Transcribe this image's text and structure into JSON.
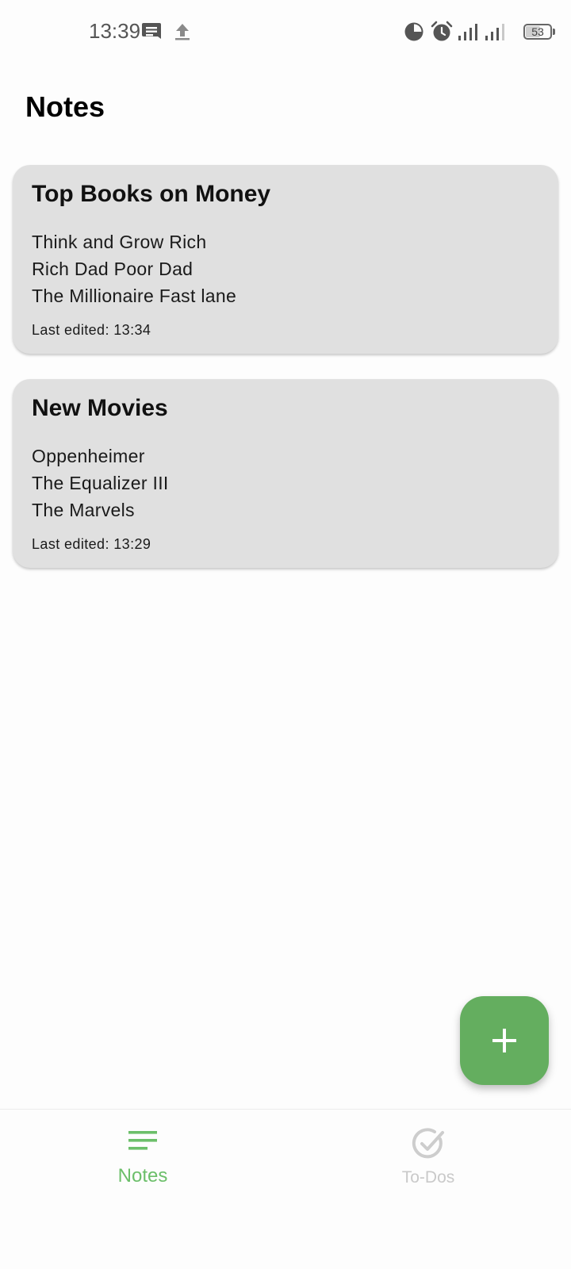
{
  "status_bar": {
    "time": "13:39",
    "battery": "53",
    "icons": [
      "message-icon",
      "upload-icon",
      "data-saver-icon",
      "alarm-icon",
      "signal-icon",
      "signal-icon"
    ]
  },
  "page": {
    "title": "Notes"
  },
  "notes": [
    {
      "title": "Top Books on Money",
      "lines": [
        "Think and Grow Rich",
        "Rich Dad Poor Dad",
        "The Millionaire Fast lane"
      ],
      "last_edited": "Last edited: 13:34"
    },
    {
      "title": "New Movies",
      "lines": [
        "Oppenheimer",
        "The Equalizer III",
        "The Marvels"
      ],
      "last_edited": "Last edited: 13:29"
    }
  ],
  "fab": {
    "icon": "plus-icon"
  },
  "bottom_nav": {
    "items": [
      {
        "label": "Notes",
        "icon": "notes-icon",
        "active": true
      },
      {
        "label": "To-Dos",
        "icon": "check-circle-icon",
        "active": false
      }
    ]
  },
  "colors": {
    "accent": "#64ae5f",
    "accent_light": "#6cbf6a",
    "card_bg": "#e0e0e0",
    "inactive": "#c9c9c9"
  }
}
